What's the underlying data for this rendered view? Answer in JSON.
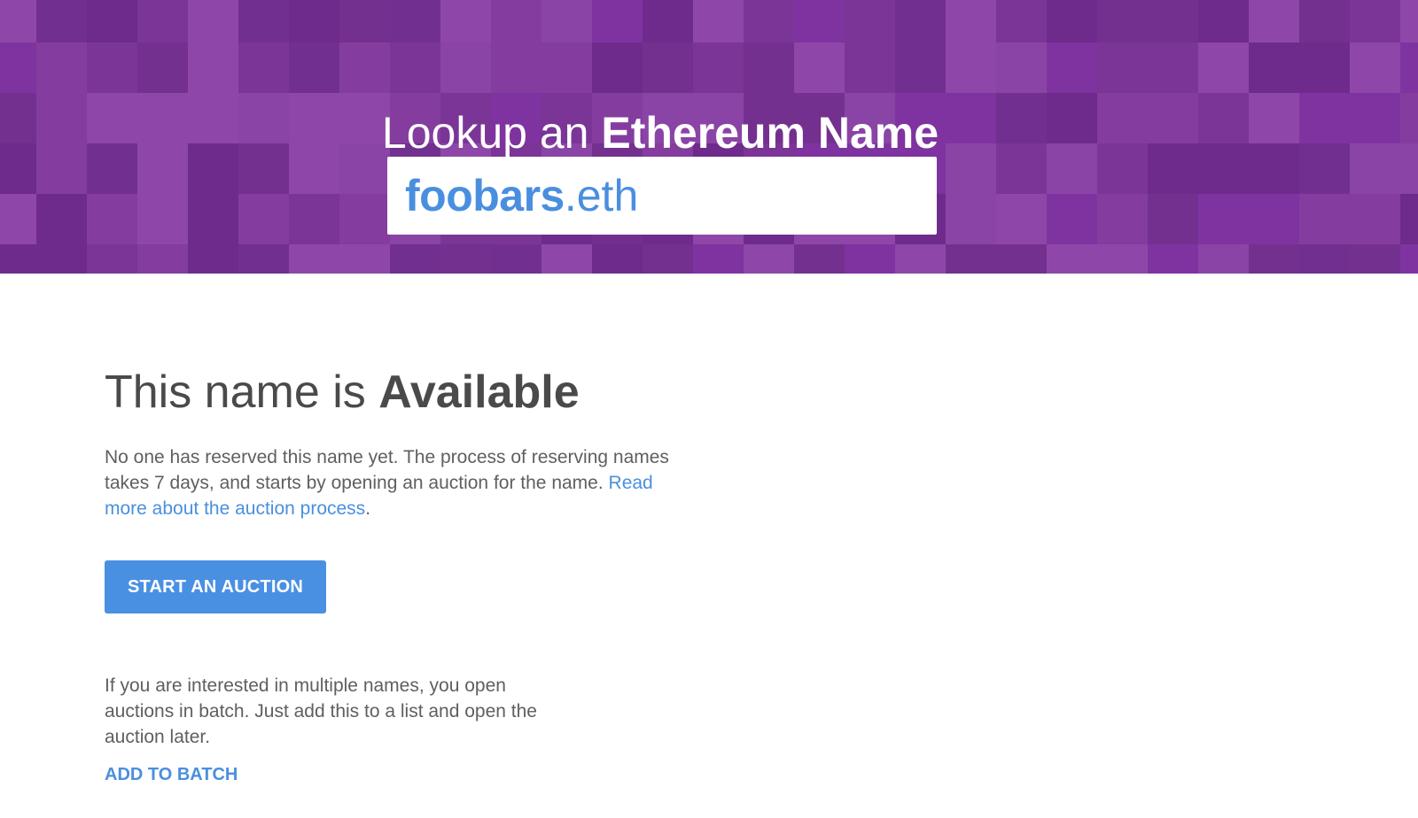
{
  "hero": {
    "title_light": "Lookup an ",
    "title_bold": "Ethereum Name",
    "search": {
      "name": "foobars",
      "tld": ".eth"
    },
    "colors": [
      "#6e2b8c",
      "#7a3597",
      "#843d9f",
      "#8e47a8",
      "#713090",
      "#7f33a0",
      "#8a44a6",
      "#74308f"
    ]
  },
  "status": {
    "heading_light": "This name is ",
    "heading_bold": "Available",
    "description": "No one has reserved this name yet. The process of reserving names takes 7 days, and starts by opening an auction for the name. ",
    "read_more_link": "Read more about the auction process",
    "description_end": ".",
    "start_auction_label": "START AN AUCTION"
  },
  "batch": {
    "description": "If you are interested in multiple names, you open auctions in batch. Just add this to a list and open the auction later.",
    "add_to_batch_label": "ADD TO BATCH"
  },
  "accent_color": "#4a90e2"
}
